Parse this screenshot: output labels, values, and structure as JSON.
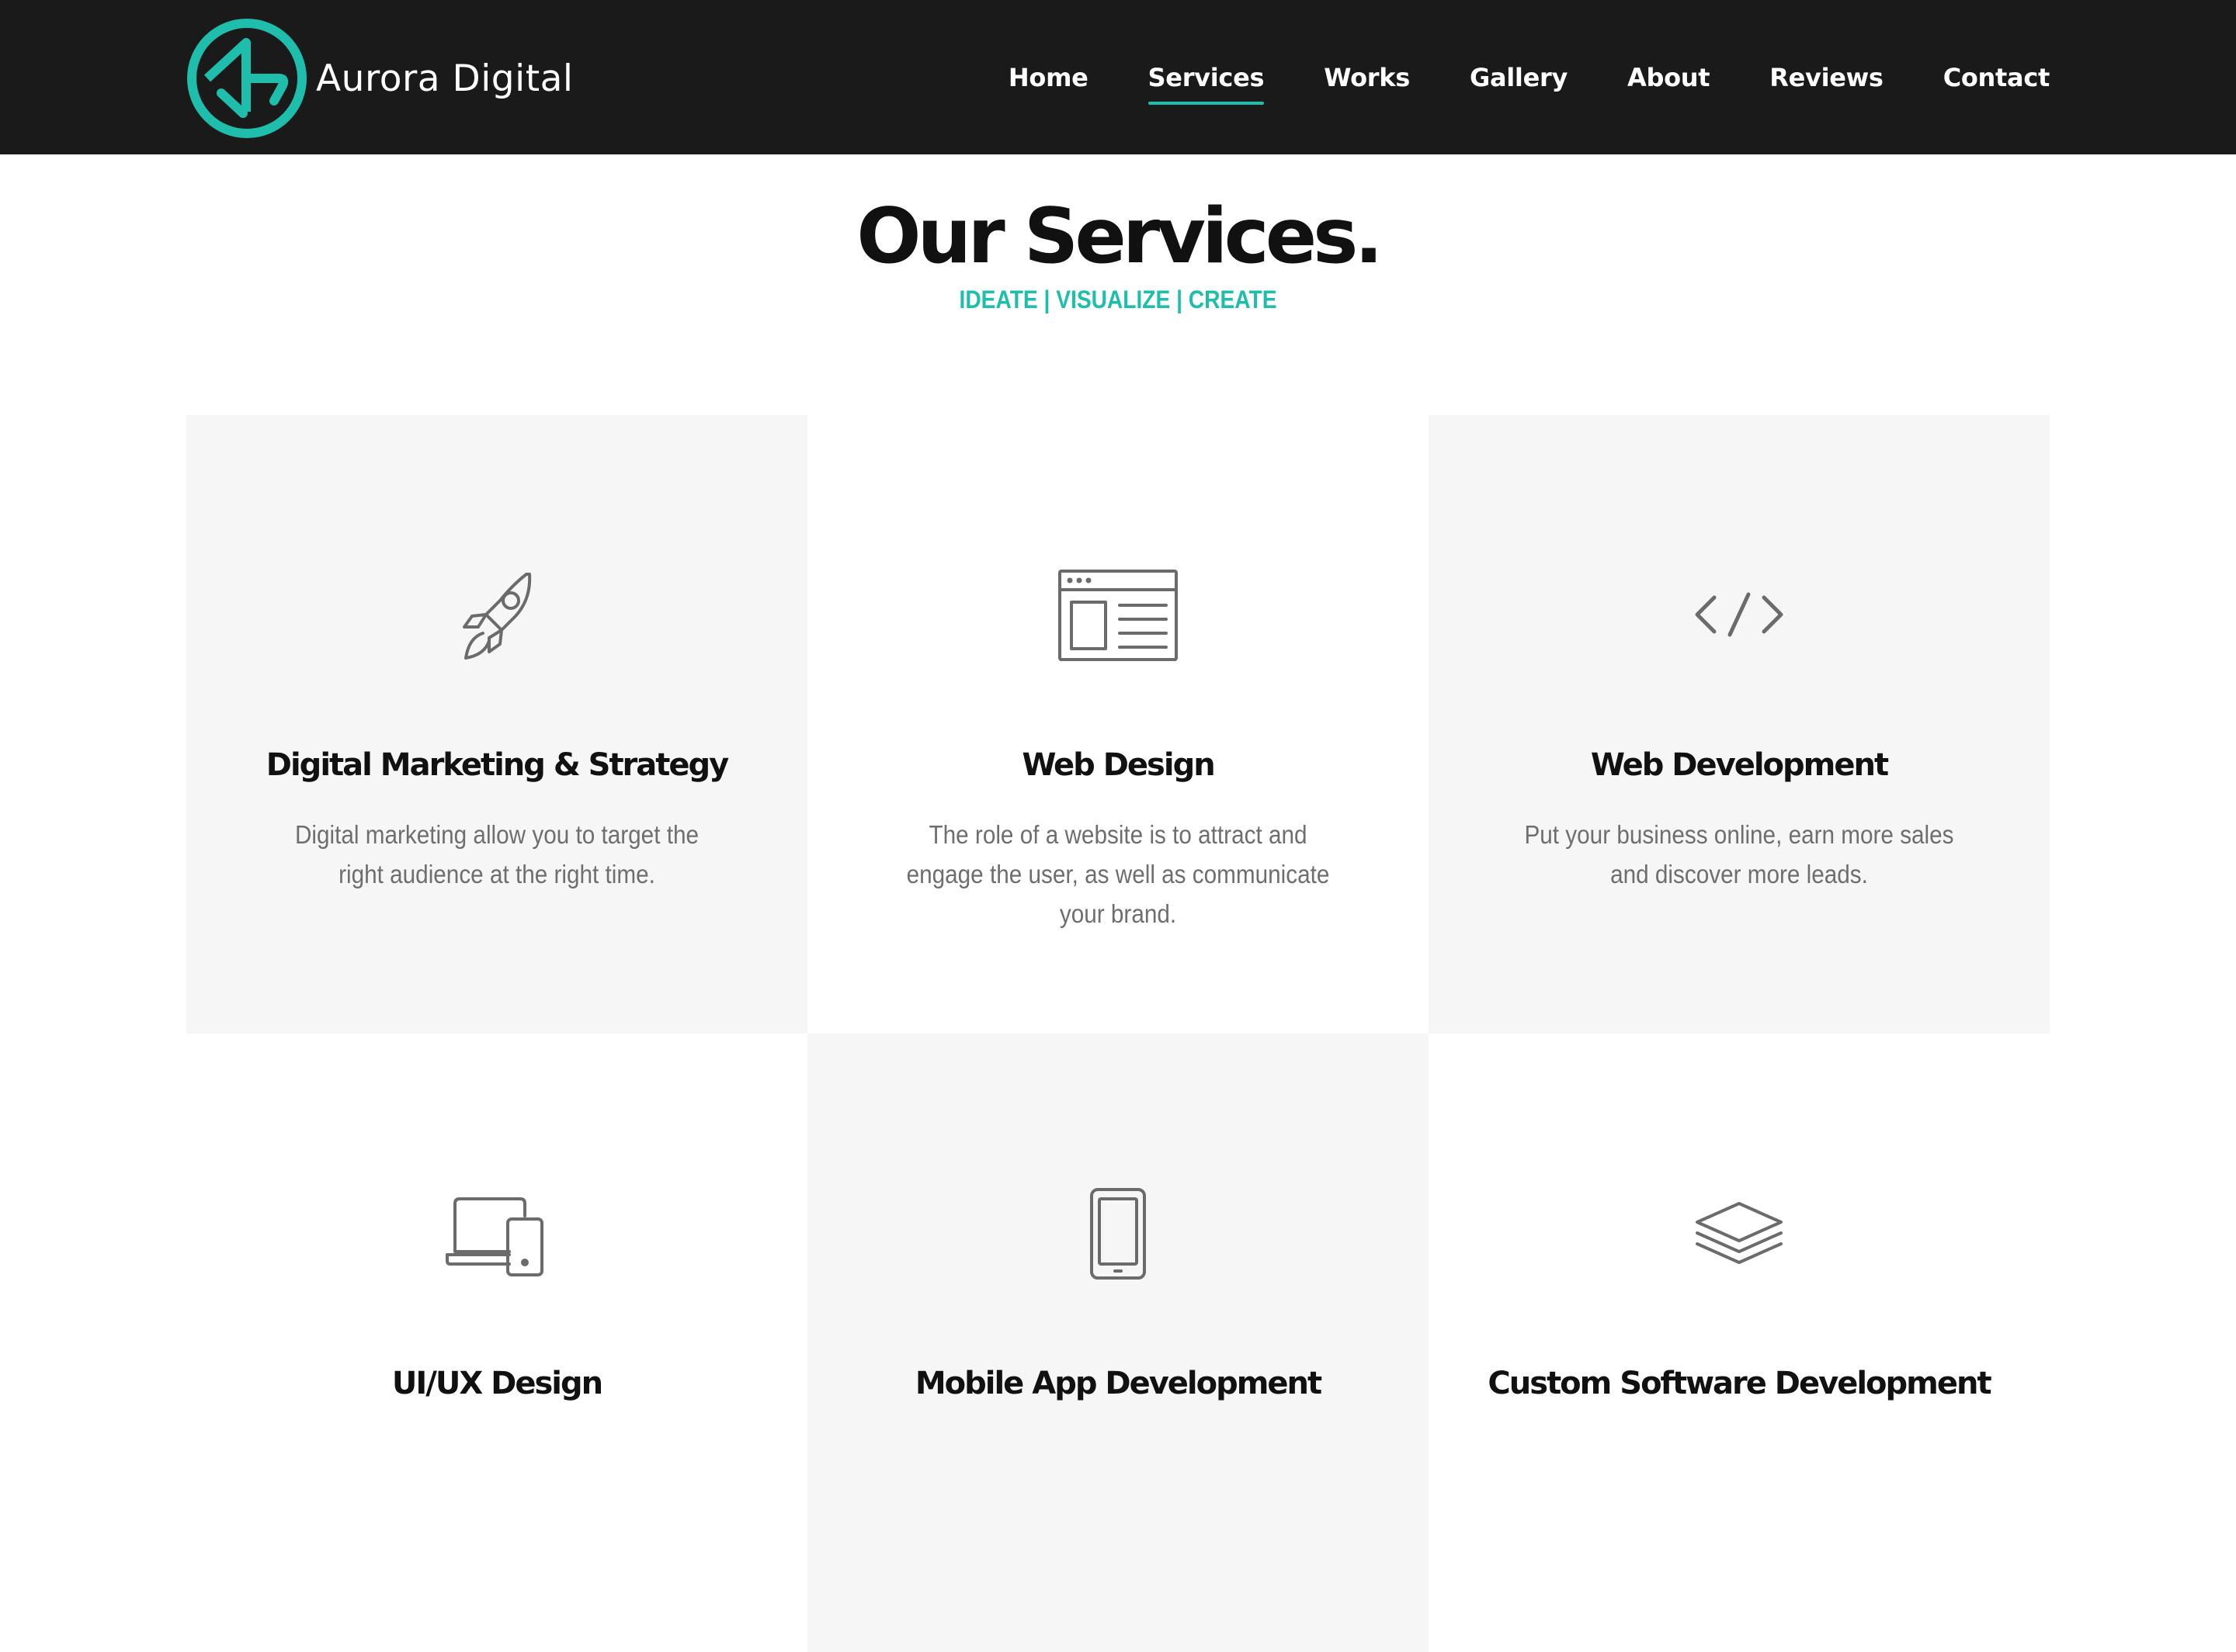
{
  "brand": {
    "name": "Aurora Digital",
    "accent_color": "#1ebdac",
    "header_bg": "#1a1a1a"
  },
  "nav": {
    "items": [
      {
        "label": "Home"
      },
      {
        "label": "Services",
        "active": true
      },
      {
        "label": "Works"
      },
      {
        "label": "Gallery"
      },
      {
        "label": "About"
      },
      {
        "label": "Reviews"
      },
      {
        "label": "Contact"
      }
    ]
  },
  "section": {
    "title": "Our Services.",
    "subtitle": "IDEATE | VISUALIZE | CREATE"
  },
  "services": [
    {
      "icon": "rocket-icon",
      "title": "Digital Marketing & Strategy",
      "description": "Digital marketing allow you to target the right audience at the right time."
    },
    {
      "icon": "browser-window-icon",
      "title": "Web Design",
      "description": "The role of a website is to attract and engage the user, as well as communicate your brand."
    },
    {
      "icon": "code-icon",
      "title": "Web Development",
      "description": "Put your business online, earn more sales and discover more leads."
    },
    {
      "icon": "devices-icon",
      "title": "UI/UX Design",
      "description": ""
    },
    {
      "icon": "smartphone-icon",
      "title": "Mobile App Development",
      "description": ""
    },
    {
      "icon": "layers-icon",
      "title": "Custom Software Development",
      "description": ""
    }
  ]
}
